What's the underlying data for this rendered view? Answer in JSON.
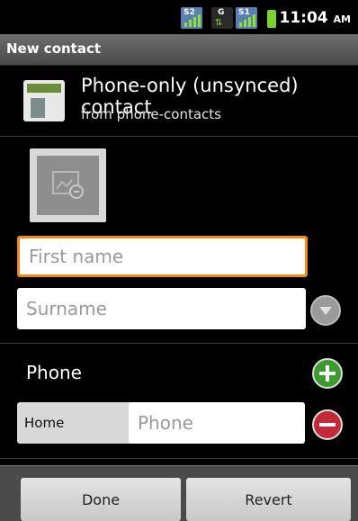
{
  "status_bar": {
    "time": "11:04",
    "ampm": "AM",
    "signal1_label": "S2",
    "data_label": "G",
    "signal2_label": "S1",
    "icons": [
      "signal-icon",
      "data-transfer-icon",
      "signal-icon",
      "battery-icon"
    ]
  },
  "title": "New contact",
  "account": {
    "title": "Phone-only (unsynced) contact",
    "subtitle": "from phone-contacts"
  },
  "fields": {
    "first_name_placeholder": "First name",
    "surname_placeholder": "Surname"
  },
  "phone_section": {
    "label": "Phone",
    "type": "Home",
    "phone_placeholder": "Phone"
  },
  "buttons": {
    "done": "Done",
    "revert": "Revert"
  },
  "colors": {
    "focus_border": "#f28a1a",
    "add": "#3c9b2d",
    "remove": "#c22a3c"
  }
}
